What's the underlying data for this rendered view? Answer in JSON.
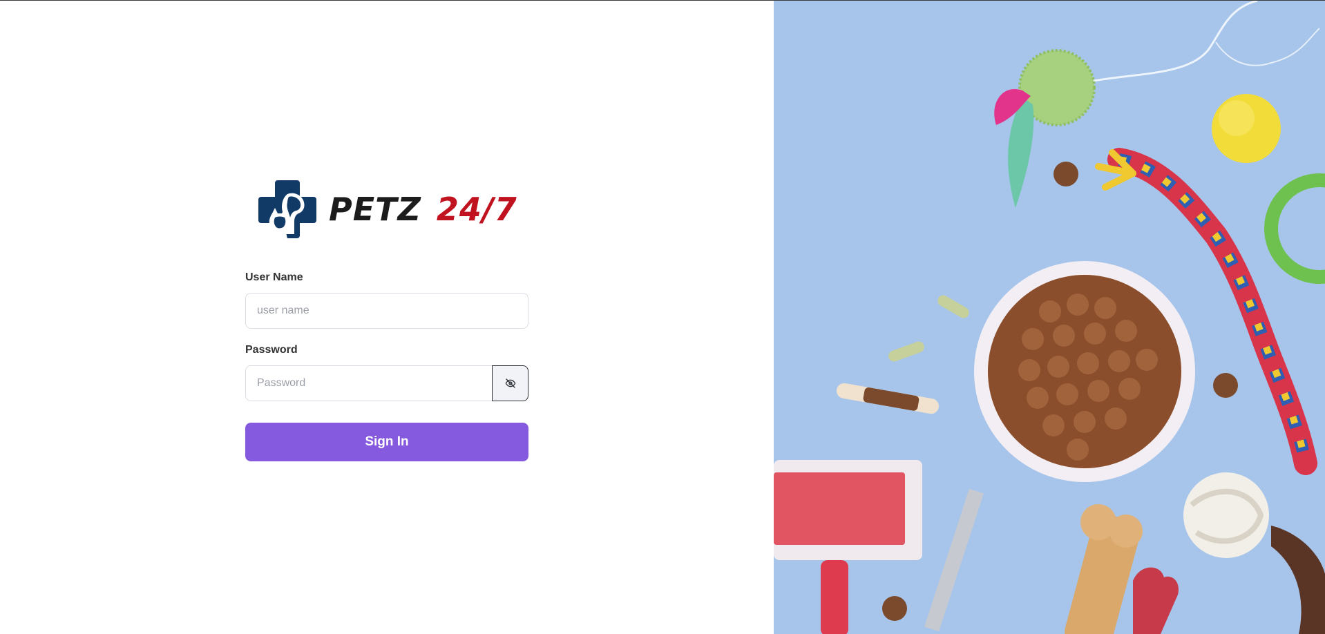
{
  "brand": {
    "logo_icon": "pet-cross-logo-icon",
    "name_word": "PETZ",
    "name_number": "24/7",
    "colors": {
      "navy": "#123a66",
      "red": "#c1121f",
      "dark": "#1c1c1c"
    }
  },
  "form": {
    "username_label": "User Name",
    "username_placeholder": "user name",
    "password_label": "Password",
    "password_placeholder": "Password",
    "toggle_icon": "eye-off-icon",
    "submit_label": "Sign In"
  },
  "hero": {
    "image": "pet-supplies-photo",
    "background_color": "#a9c7ec"
  },
  "colors": {
    "accent": "#855ade"
  }
}
